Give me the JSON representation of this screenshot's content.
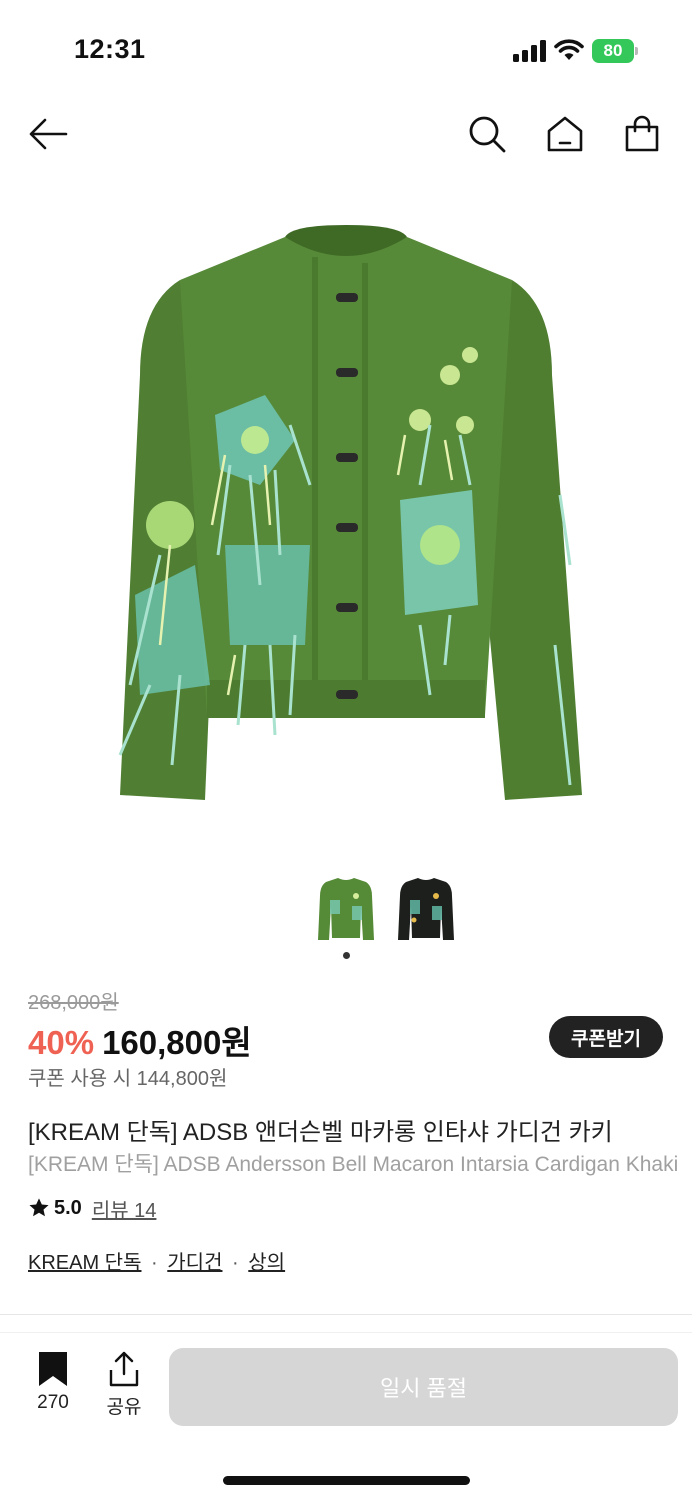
{
  "status_bar": {
    "time": "12:31",
    "battery": "80",
    "icons": [
      "signal-icon",
      "wifi-icon",
      "battery-icon"
    ],
    "battery_color": "#34c759"
  },
  "nav": {
    "icons": [
      "back-arrow-icon",
      "search-icon",
      "home-icon",
      "shopping-bag-icon"
    ]
  },
  "gallery": {
    "image": "green-mohair-cardigan-image",
    "thumbnails": [
      "green-cardigan-thumbnail",
      "black-cardigan-thumbnail"
    ],
    "active_index": 0
  },
  "price": {
    "original": "268,000원",
    "discount_rate": "40%",
    "sale_price": "160,800원",
    "coupon_price": "쿠폰 사용 시 144,800원",
    "coupon_button": "쿠폰받기",
    "discount_color": "#ef6253"
  },
  "product": {
    "name_ko": "[KREAM 단독] ADSB 앤더슨벨 마카롱 인타샤 가디건 카키",
    "name_en": "[KREAM 단독] ADSB Andersson Bell Macaron Intarsia Cardigan Khaki"
  },
  "rating": {
    "value": "5.0",
    "review_label": "리뷰 14"
  },
  "categories": {
    "items": [
      "KREAM 단독",
      "가디건",
      "상의"
    ],
    "separator": "·"
  },
  "bottom_bar": {
    "bookmark_count": "270",
    "share_label": "공유",
    "soldout_label": "일시 품절"
  }
}
